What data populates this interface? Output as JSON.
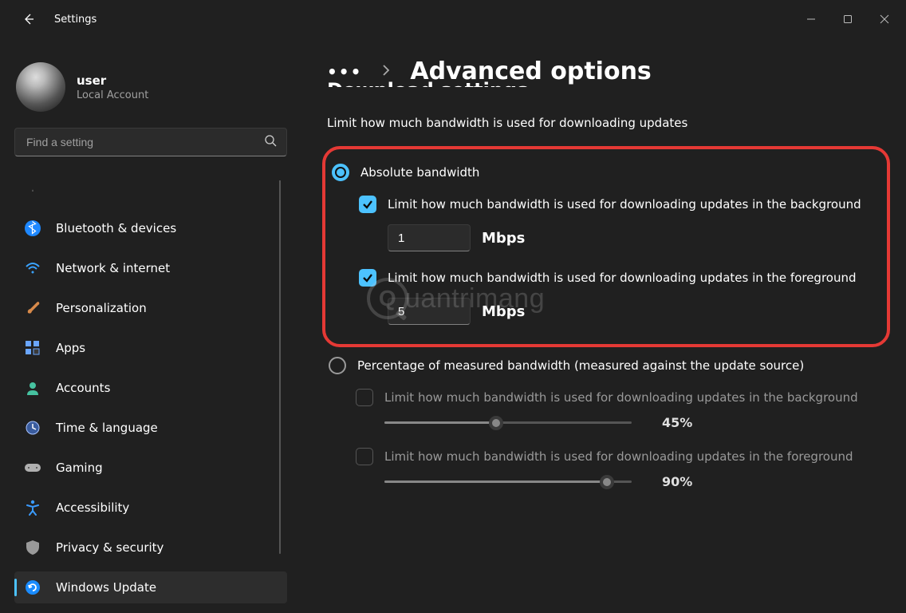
{
  "titlebar": {
    "title": "Settings"
  },
  "profile": {
    "name": "user",
    "sub": "Local Account"
  },
  "search": {
    "placeholder": "Find a setting"
  },
  "nav": [
    {
      "label": "Bluetooth & devices",
      "icon": "bluetooth"
    },
    {
      "label": "Network & internet",
      "icon": "wifi"
    },
    {
      "label": "Personalization",
      "icon": "brush"
    },
    {
      "label": "Apps",
      "icon": "apps"
    },
    {
      "label": "Accounts",
      "icon": "person"
    },
    {
      "label": "Time & language",
      "icon": "clock"
    },
    {
      "label": "Gaming",
      "icon": "gamepad"
    },
    {
      "label": "Accessibility",
      "icon": "accessibility"
    },
    {
      "label": "Privacy & security",
      "icon": "shield"
    },
    {
      "label": "Windows Update",
      "icon": "update",
      "selected": true
    }
  ],
  "breadcrumb": {
    "title": "Advanced options"
  },
  "section_cut": "Download settings",
  "subtitle": "Limit how much bandwidth is used for downloading updates",
  "absolute": {
    "label": "Absolute bandwidth",
    "bg_check_label": "Limit how much bandwidth is used for downloading updates in the background",
    "bg_value": "1",
    "bg_unit": "Mbps",
    "fg_check_label": "Limit how much bandwidth is used for downloading updates in the foreground",
    "fg_value": "5",
    "fg_unit": "Mbps"
  },
  "percentage": {
    "label": "Percentage of measured bandwidth (measured against the update source)",
    "bg_check_label": "Limit how much bandwidth is used for downloading updates in the background",
    "bg_pct": "45%",
    "bg_pct_val": 45,
    "fg_check_label": "Limit how much bandwidth is used for downloading updates in the foreground",
    "fg_pct": "90%",
    "fg_pct_val": 90
  },
  "watermark": {
    "letter": "Q",
    "rest": "uantrimang"
  }
}
